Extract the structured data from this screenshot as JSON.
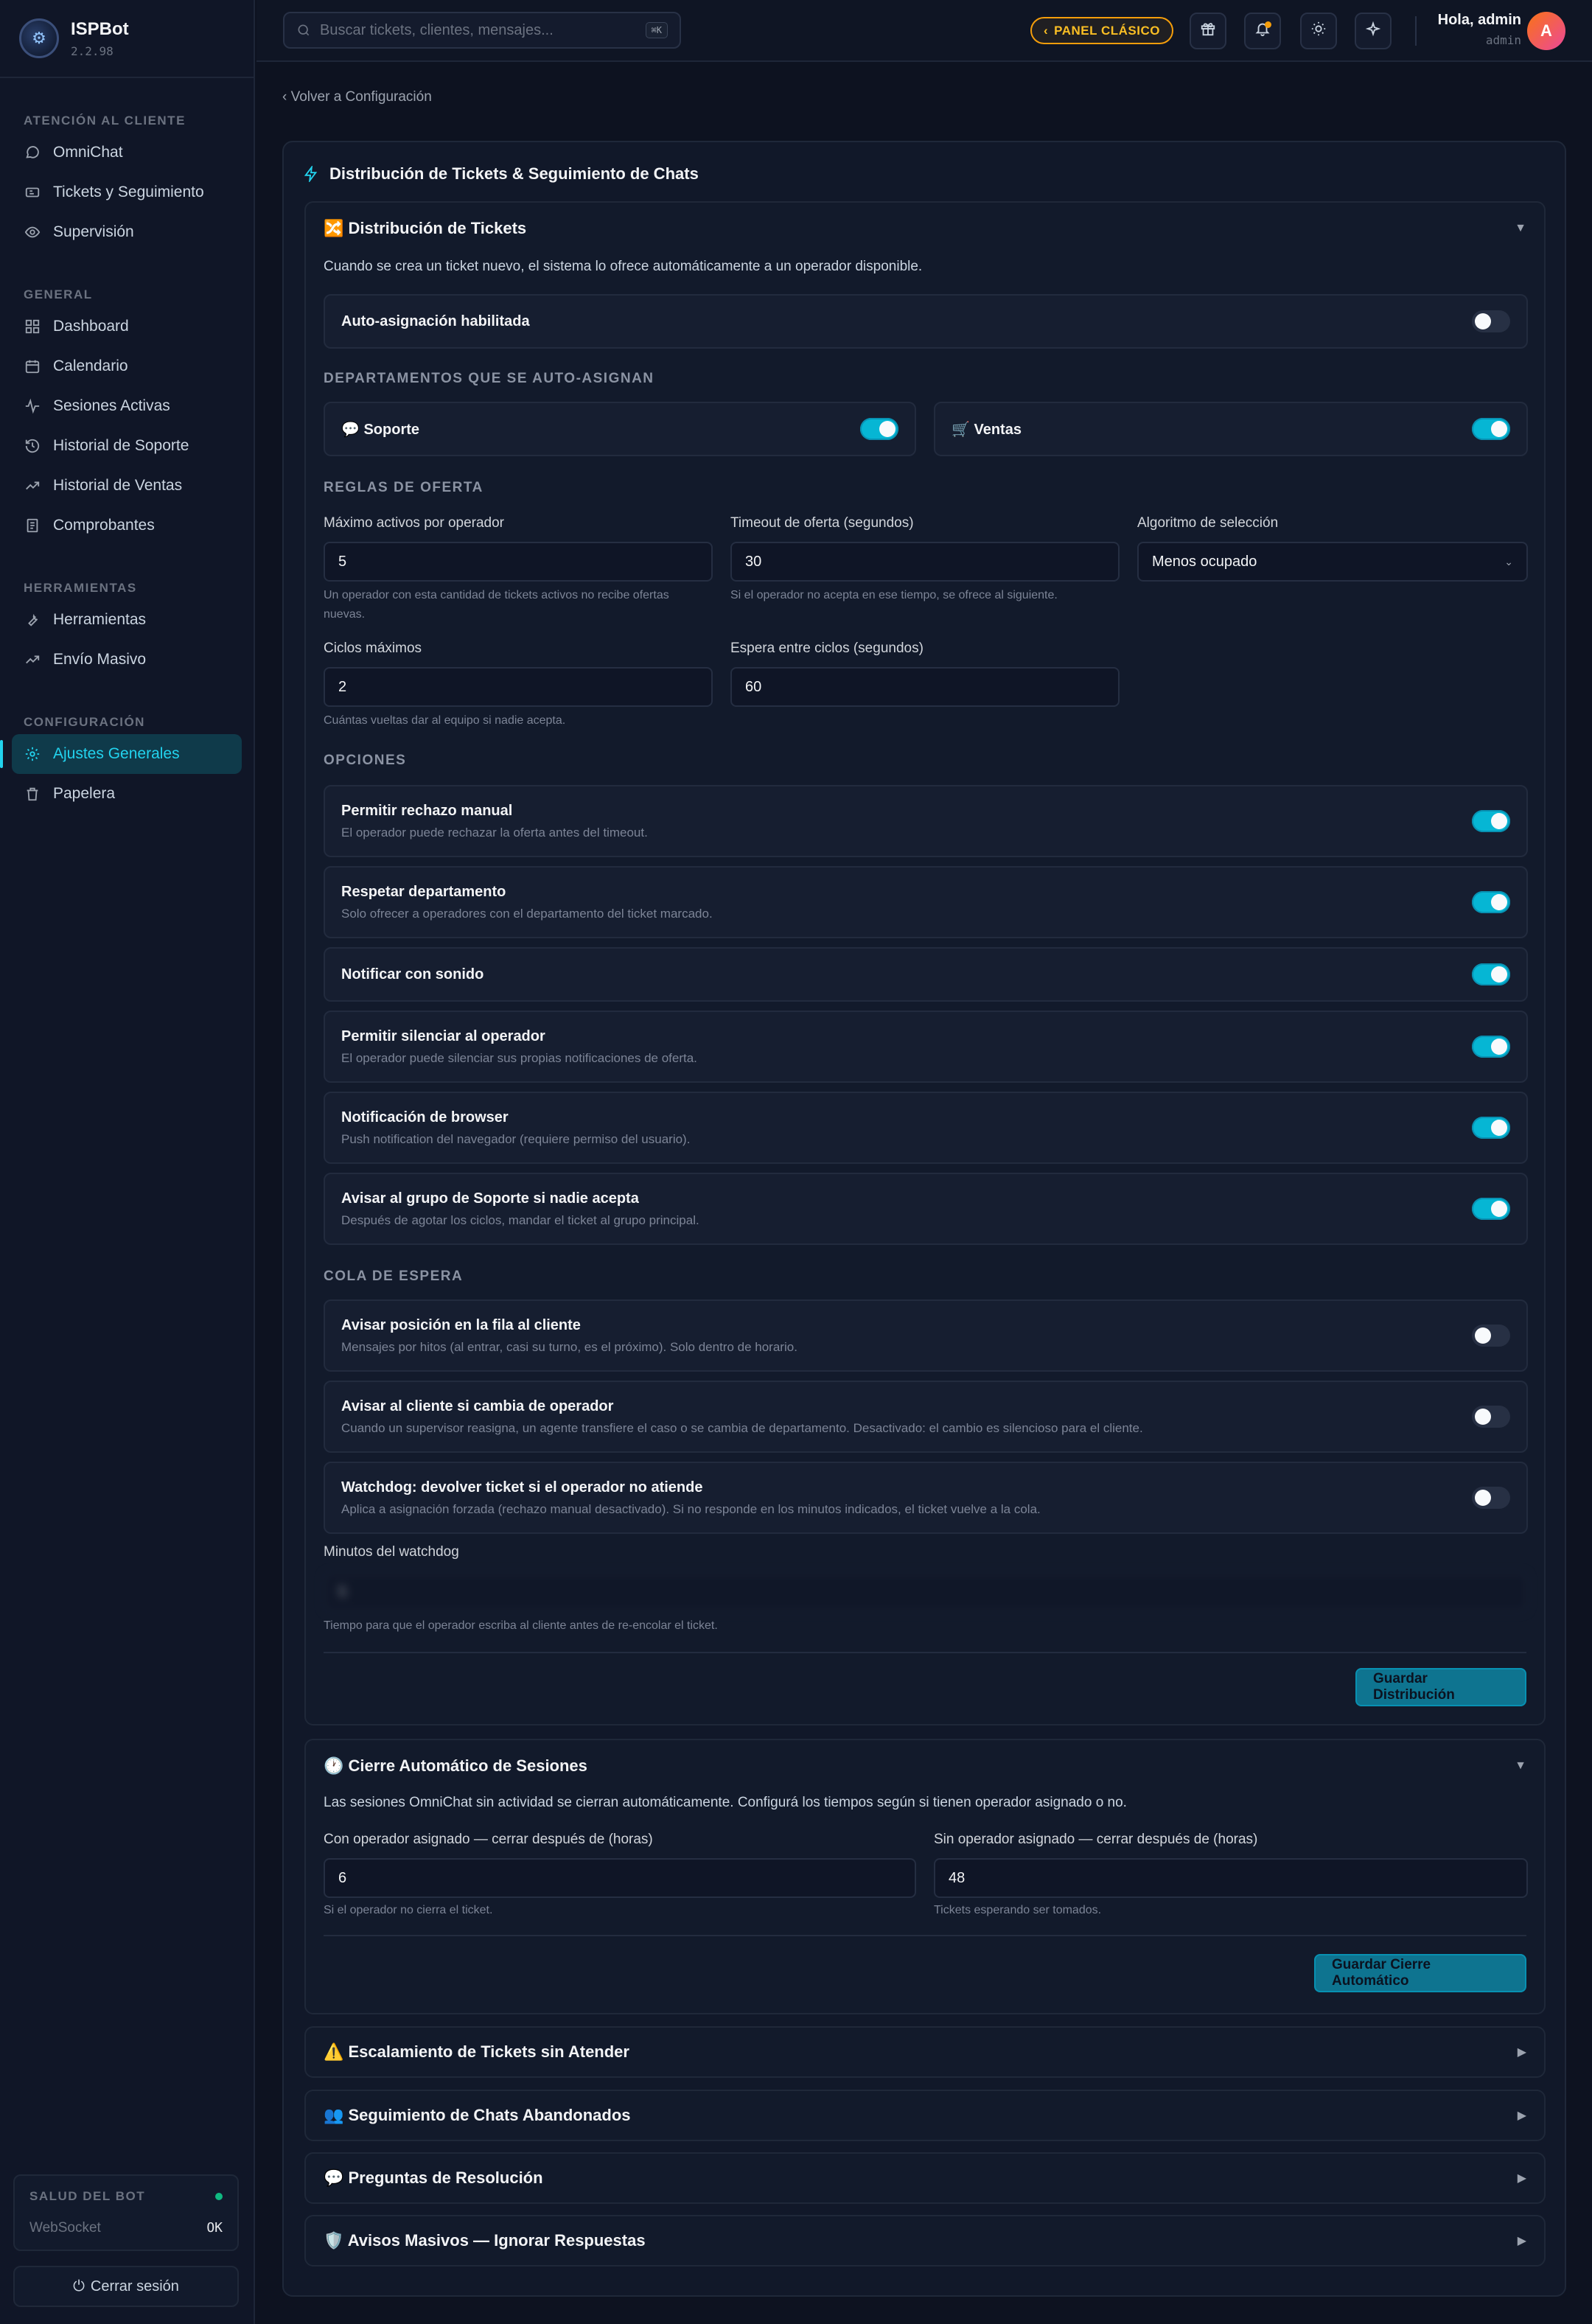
{
  "brand": {
    "name": "ISPBot",
    "version": "2.2.98",
    "logo_icon": "robot-logo"
  },
  "sidebar": {
    "sections": [
      {
        "heading": "ATENCIÓN AL CLIENTE",
        "items": [
          {
            "label": "OmniChat",
            "icon": "chat-icon"
          },
          {
            "label": "Tickets y Seguimiento",
            "icon": "ticket-icon"
          },
          {
            "label": "Supervisión",
            "icon": "eye-icon"
          }
        ]
      },
      {
        "heading": "GENERAL",
        "items": [
          {
            "label": "Dashboard",
            "icon": "grid-icon"
          },
          {
            "label": "Calendario",
            "icon": "calendar-icon"
          },
          {
            "label": "Sesiones Activas",
            "icon": "activity-icon"
          },
          {
            "label": "Historial de Soporte",
            "icon": "history-icon"
          },
          {
            "label": "Historial de Ventas",
            "icon": "trend-icon"
          },
          {
            "label": "Comprobantes",
            "icon": "receipt-icon"
          }
        ]
      },
      {
        "heading": "HERRAMIENTAS",
        "items": [
          {
            "label": "Herramientas",
            "icon": "wrench-icon"
          },
          {
            "label": "Envío Masivo",
            "icon": "send-trend-icon"
          }
        ]
      },
      {
        "heading": "CONFIGURACIÓN",
        "items": [
          {
            "label": "Ajustes Generales",
            "icon": "gear-icon",
            "active": true
          },
          {
            "label": "Papelera",
            "icon": "trash-icon"
          }
        ]
      }
    ],
    "health": {
      "title": "SALUD DEL BOT",
      "label": "WebSocket",
      "value": "OK",
      "status_color": "#10b981"
    },
    "logout_label": "Cerrar sesión"
  },
  "topbar": {
    "search_placeholder": "Buscar tickets, clientes, mensajes...",
    "search_shortcut": "⌘K",
    "panel_button": "PANEL CLÁSICO",
    "greeting": "Hola, admin",
    "role": "admin",
    "avatar_initial": "A"
  },
  "main": {
    "back_link": "‹ Volver a Configuración",
    "card_title": "Distribución de Tickets & Seguimiento de Chats",
    "distribution": {
      "title": "🔀 Distribución de Tickets",
      "description": "Cuando se crea un ticket nuevo, el sistema lo ofrece automáticamente a un operador disponible.",
      "auto_assign": {
        "label": "Auto-asignación habilitada",
        "on": false
      },
      "departments_heading": "DEPARTAMENTOS QUE SE AUTO-ASIGNAN",
      "departments": [
        {
          "label": "💬 Soporte",
          "on": true
        },
        {
          "label": "🛒 Ventas",
          "on": true
        }
      ],
      "rules_heading": "REGLAS DE OFERTA",
      "rules": {
        "max_active": {
          "label": "Máximo activos por operador",
          "value": "5",
          "help": "Un operador con esta cantidad de tickets activos no recibe ofertas nuevas."
        },
        "timeout": {
          "label": "Timeout de oferta (segundos)",
          "value": "30",
          "help": "Si el operador no acepta en ese tiempo, se ofrece al siguiente."
        },
        "algorithm": {
          "label": "Algoritmo de selección",
          "value": "Menos ocupado"
        },
        "max_cycles": {
          "label": "Ciclos máximos",
          "value": "2",
          "help": "Cuántas vueltas dar al equipo si nadie acepta."
        },
        "cycle_wait": {
          "label": "Espera entre ciclos (segundos)",
          "value": "60"
        }
      },
      "options_heading": "OPCIONES",
      "options": [
        {
          "label": "Permitir rechazo manual",
          "help": "El operador puede rechazar la oferta antes del timeout.",
          "on": true
        },
        {
          "label": "Respetar departamento",
          "help": "Solo ofrecer a operadores con el departamento del ticket marcado.",
          "on": true
        },
        {
          "label": "Notificar con sonido",
          "help": "",
          "on": true
        },
        {
          "label": "Permitir silenciar al operador",
          "help": "El operador puede silenciar sus propias notificaciones de oferta.",
          "on": true
        },
        {
          "label": "Notificación de browser",
          "help": "Push notification del navegador (requiere permiso del usuario).",
          "on": true
        },
        {
          "label": "Avisar al grupo de Soporte si nadie acepta",
          "help": "Después de agotar los ciclos, mandar el ticket al grupo principal.",
          "on": true
        }
      ],
      "queue_heading": "COLA DE ESPERA",
      "queue": [
        {
          "label": "Avisar posición en la fila al cliente",
          "help": "Mensajes por hitos (al entrar, casi su turno, es el próximo). Solo dentro de horario.",
          "on": false
        },
        {
          "label": "Avisar al cliente si cambia de operador",
          "help": "Cuando un supervisor reasigna, un agente transfiere el caso o se cambia de departamento. Desactivado: el cambio es silencioso para el cliente.",
          "on": false
        },
        {
          "label": "Watchdog: devolver ticket si el operador no atiende",
          "help": "Aplica a asignación forzada (rechazo manual desactivado). Si no responde en los minutos indicados, el ticket vuelve a la cola.",
          "on": false
        }
      ],
      "watchdog": {
        "label": "Minutos del watchdog",
        "value": "5",
        "help": "Tiempo para que el operador escriba al cliente antes de re-encolar el ticket."
      },
      "save_label": "Guardar Distribución"
    },
    "auto_close": {
      "title": "🕐 Cierre Automático de Sesiones",
      "description": "Las sesiones OmniChat sin actividad se cierran automáticamente. Configurá los tiempos según si tienen operador asignado o no.",
      "with_operator": {
        "label": "Con operador asignado — cerrar después de (horas)",
        "value": "6",
        "help": "Si el operador no cierra el ticket."
      },
      "without_operator": {
        "label": "Sin operador asignado — cerrar después de (horas)",
        "value": "48",
        "help": "Tickets esperando ser tomados."
      },
      "save_label": "Guardar Cierre Automático"
    },
    "collapsed_sections": [
      {
        "title": "⚠️ Escalamiento de Tickets sin Atender"
      },
      {
        "title": "👥 Seguimiento de Chats Abandonados"
      },
      {
        "title": "💬 Preguntas de Resolución"
      },
      {
        "title": "🛡️ Avisos Masivos — Ignorar Respuestas"
      }
    ],
    "caret_open": "▼",
    "caret_closed": "▶"
  }
}
